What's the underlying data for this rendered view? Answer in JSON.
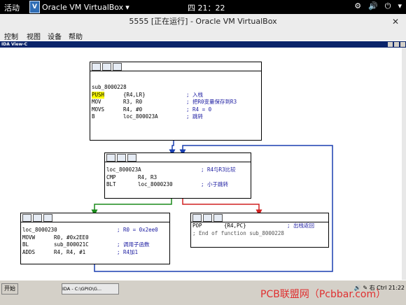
{
  "topbar": {
    "activities": "活动",
    "app_name": "Oracle VM VirtualBox",
    "clock": "四 21：22",
    "tray": [
      "⚙",
      "🔊",
      "⏻",
      "▾"
    ]
  },
  "window": {
    "title": "5555 [正在运行] - Oracle VM VirtualBox",
    "close": "✕"
  },
  "menu": [
    "控制",
    "视图",
    "设备",
    "帮助"
  ],
  "ida_view": {
    "caption": "IDA View-C"
  },
  "blocks": {
    "sub_8000228": {
      "rows": [
        {
          "a": "",
          "b": "",
          "c": ""
        },
        {
          "a": "",
          "b": "",
          "c": ""
        },
        {
          "a": "",
          "b": "",
          "c": ""
        },
        {
          "a": "sub_8000228",
          "b": "",
          "c": ""
        },
        {
          "a": "PUSH",
          "b": "{R4,LR}",
          "c": "; 入栈"
        },
        {
          "a": "MOV",
          "b": "R3, R0",
          "c": "; 把R0变量保存到R3"
        },
        {
          "a": "MOVS",
          "b": "R4, #0",
          "c": "; R4 = 0"
        },
        {
          "a": "B",
          "b": "loc_800023A",
          "c": "; 跳转"
        }
      ]
    },
    "loc_800023A": {
      "rows": [
        {
          "a": "",
          "b": "",
          "c": ""
        },
        {
          "a": "loc_800023A",
          "b": "",
          "c": "; R4与R3比较"
        },
        {
          "a": "CMP",
          "b": "R4, R3",
          "c": ""
        },
        {
          "a": "BLT",
          "b": "loc_8000230",
          "c": "; 小于跳转"
        }
      ]
    },
    "loc_8000230": {
      "rows": [
        {
          "a": "",
          "b": "",
          "c": ""
        },
        {
          "a": "loc_8000230",
          "b": "",
          "c": "; R0 = 0x2ee0"
        },
        {
          "a": "MOVW",
          "b": "R0, #0x2EE0",
          "c": ""
        },
        {
          "a": "BL",
          "b": "sub_800021C",
          "c": "; 调用子函数"
        },
        {
          "a": "ADDS",
          "b": "R4, R4, #1",
          "c": "; R4加1"
        }
      ]
    },
    "ret": {
      "rows": [
        {
          "a": "POP",
          "b": "{R4,PC}",
          "c": "; 出栈返回"
        },
        {
          "a": "; End of function sub_8000228",
          "b": "",
          "c": ""
        }
      ]
    }
  },
  "taskbar": {
    "start": "开始",
    "item": "IDA - C:\\GPIO\\G...",
    "tray": "🔊 ✎ 右 Ctrl",
    "time": "21:22"
  },
  "watermark": "PCB联盟网（Pcbbar.com）",
  "colors": {
    "edge_blue": "#1a3fb0",
    "edge_green": "#1a8a1a",
    "edge_red": "#d02020",
    "push_highlight": "#ffff00"
  }
}
